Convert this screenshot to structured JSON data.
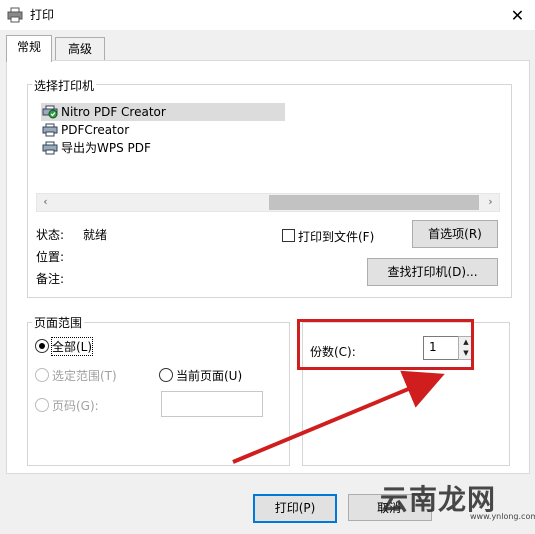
{
  "window": {
    "title": "打印",
    "close_symbol": "✕"
  },
  "tabs": [
    {
      "label": "常规",
      "active": true
    },
    {
      "label": "高级",
      "active": false
    }
  ],
  "printer_group": {
    "legend": "选择打印机",
    "printers": [
      {
        "label": "Nitro PDF Creator",
        "selected": true,
        "default": true
      },
      {
        "label": "PDFCreator",
        "selected": false
      },
      {
        "label": "导出为WPS PDF",
        "selected": false
      }
    ],
    "status_label": "状态:",
    "status_value": "就绪",
    "location_label": "位置:",
    "comment_label": "备注:",
    "print_to_file_label": "打印到文件(F)",
    "preferences_button": "首选项(R)",
    "find_printer_button": "查找打印机(D)..."
  },
  "range_group": {
    "legend": "页面范围",
    "all_label": "全部(L)",
    "selection_label": "选定范围(T)",
    "current_page_label": "当前页面(U)",
    "pages_label": "页码(G):"
  },
  "copies": {
    "label": "份数(C):",
    "value": "1"
  },
  "footer": {
    "print_button": "打印(P)",
    "cancel_button": "取消"
  },
  "watermark": {
    "text": "云南龙网",
    "url": "www.ynlong.com"
  },
  "colors": {
    "annotation_red": "#d01e1e",
    "accent_blue": "#0078d7"
  }
}
